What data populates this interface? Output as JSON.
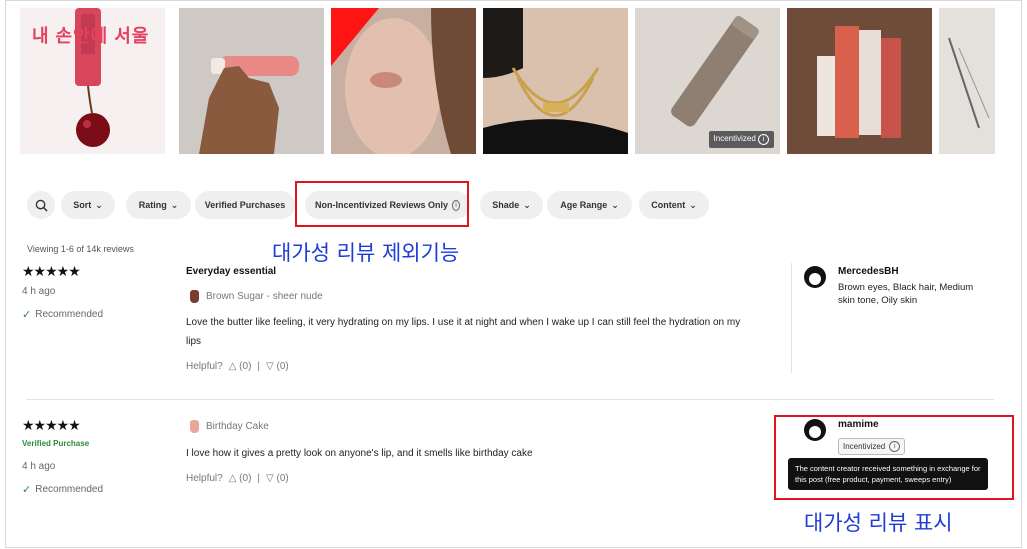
{
  "gallery": {
    "logo_text": "내 손안에 서울",
    "incentivized_tag": "Incentivized"
  },
  "filters": {
    "sort": "Sort",
    "rating": "Rating",
    "verified": "Verified Purchases",
    "non_incentivized": "Non-Incentivized Reviews Only",
    "shade": "Shade",
    "age": "Age Range",
    "content": "Content"
  },
  "annotations": {
    "filter_note": "대가성 리뷰 제외기능",
    "badge_note": "대가성 리뷰 표시"
  },
  "viewing": "Viewing 1-6 of 14k reviews",
  "reviews": [
    {
      "stars": "★★★★★",
      "verified": "",
      "time": "4 h ago",
      "recommended": "Recommended",
      "title": "Everyday essential",
      "shade": "Brown Sugar - sheer nude",
      "shade_color": "#7b3b2e",
      "body": "Love the butter like feeling, it very hydrating on my lips. I use it at night and when I wake up I can still feel the hydration on my lips",
      "helpful_label": "Helpful?",
      "up_count": "(0)",
      "sep": "|",
      "down_count": "(0)",
      "user": "MercedesBH",
      "user_info": "Brown eyes, Black hair, Medium skin tone, Oily skin"
    },
    {
      "stars": "★★★★★",
      "verified": "Verified Purchase",
      "time": "4 h ago",
      "recommended": "Recommended",
      "title": "",
      "shade": "Birthday Cake",
      "shade_color": "#e8a79a",
      "body": "I love how it gives a pretty look on anyone's lip, and it smells like birthday cake",
      "helpful_label": "Helpful?",
      "up_count": "(0)",
      "sep": "|",
      "down_count": "(0)",
      "user": "mamime",
      "incentivized": "Incentivized",
      "tooltip": "The content creator received something in exchange for this post (free product, payment, sweeps entry)"
    }
  ],
  "colors": {
    "annotation_red": "#e0141d",
    "annotation_blue": "#1d3dd6",
    "verified_green": "#2a8a3a"
  }
}
